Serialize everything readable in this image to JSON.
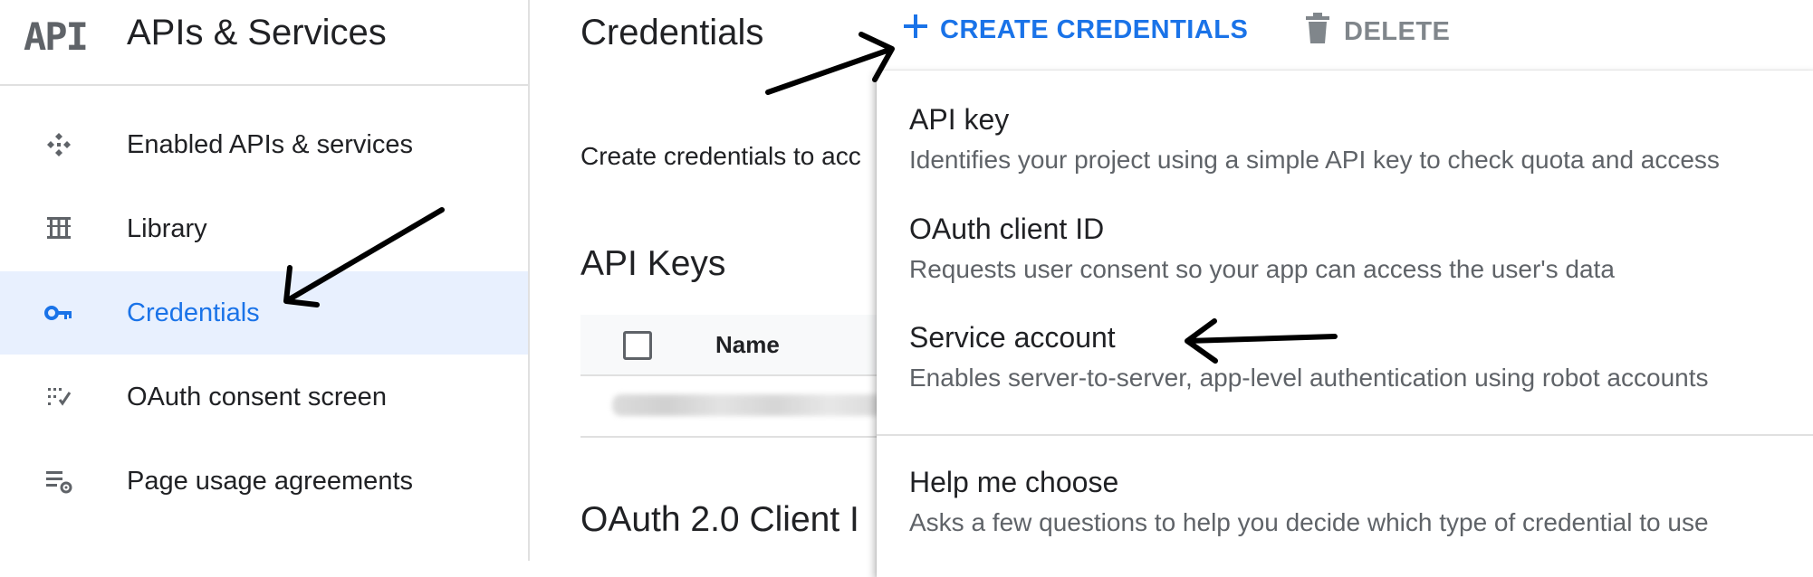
{
  "header": {
    "logo_text": "API",
    "product_title": "APIs & Services"
  },
  "sidebar": {
    "items": [
      {
        "label": "Enabled APIs & services",
        "icon": "enabled-apis-icon",
        "active": false
      },
      {
        "label": "Library",
        "icon": "library-icon",
        "active": false
      },
      {
        "label": "Credentials",
        "icon": "key-icon",
        "active": true
      },
      {
        "label": "OAuth consent screen",
        "icon": "oauth-consent-icon",
        "active": false
      },
      {
        "label": "Page usage agreements",
        "icon": "settings-list-icon",
        "active": false
      }
    ]
  },
  "main": {
    "page_title": "Credentials",
    "create_button_label": "CREATE CREDENTIALS",
    "delete_button_label": "DELETE",
    "intro_text": "Create credentials to acc",
    "api_keys_heading": "API Keys",
    "table_column_name": "Name",
    "oauth_heading": "OAuth 2.0 Client I"
  },
  "menu": {
    "items": [
      {
        "title": "API key",
        "description": "Identifies your project using a simple API key to check quota and access"
      },
      {
        "title": "OAuth client ID",
        "description": "Requests user consent so your app can access the user's data"
      },
      {
        "title": "Service account",
        "description": "Enables server-to-server, app-level authentication using robot accounts"
      },
      {
        "title": "Help me choose",
        "description": "Asks a few questions to help you decide which type of credential to use"
      }
    ]
  },
  "colors": {
    "accent": "#1a73e8",
    "active_bg": "#e8f0fe",
    "text": "#202124",
    "secondary_text": "#5f6368",
    "divider": "#e0e0e0"
  }
}
